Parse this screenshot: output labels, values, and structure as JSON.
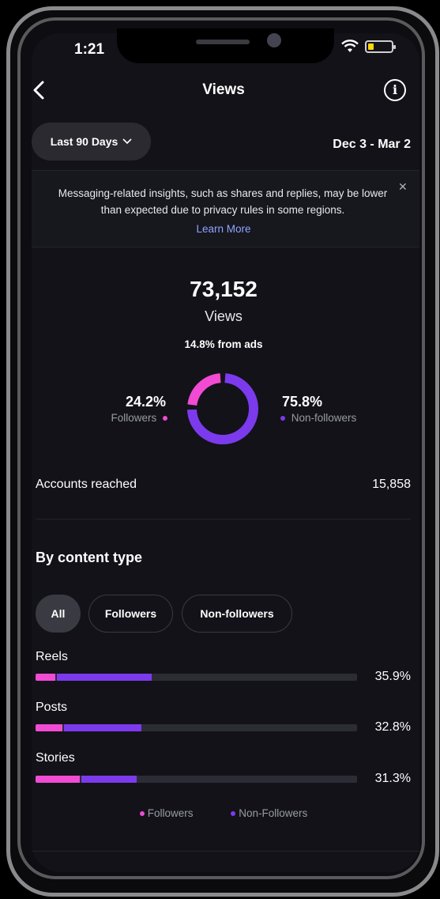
{
  "status_bar": {
    "time": "1:21"
  },
  "header": {
    "title": "Views"
  },
  "range_selector": {
    "label": "Last 90 Days",
    "date_range": "Dec 3 - Mar 2"
  },
  "notice": {
    "text": "Messaging-related insights, such as shares and replies, may be lower than expected due to privacy rules in some regions.",
    "link": "Learn More"
  },
  "summary": {
    "total": "73,152",
    "total_label": "Views",
    "ads_note": "14.8% from ads",
    "followers_pct": "24.2%",
    "followers_label": "Followers",
    "non_followers_pct": "75.8%",
    "non_followers_label": "Non-followers",
    "followers_share": 0.242
  },
  "accounts_reached": {
    "label": "Accounts reached",
    "value": "15,858"
  },
  "content_type": {
    "title": "By content type",
    "filters": [
      "All",
      "Followers",
      "Non-followers"
    ],
    "rows": [
      {
        "label": "Reels",
        "followers": 6.3,
        "non_followers": 29.6,
        "pct": "35.9%"
      },
      {
        "label": "Posts",
        "followers": 8.5,
        "non_followers": 24.3,
        "pct": "32.8%"
      },
      {
        "label": "Stories",
        "followers": 14.0,
        "non_followers": 17.3,
        "pct": "31.3%"
      }
    ],
    "legend": {
      "followers": "Followers",
      "non_followers": "Non-Followers"
    }
  },
  "colors": {
    "followers": "#f04bd2",
    "non_followers": "#7c3aed",
    "track": "#2c2c34"
  }
}
